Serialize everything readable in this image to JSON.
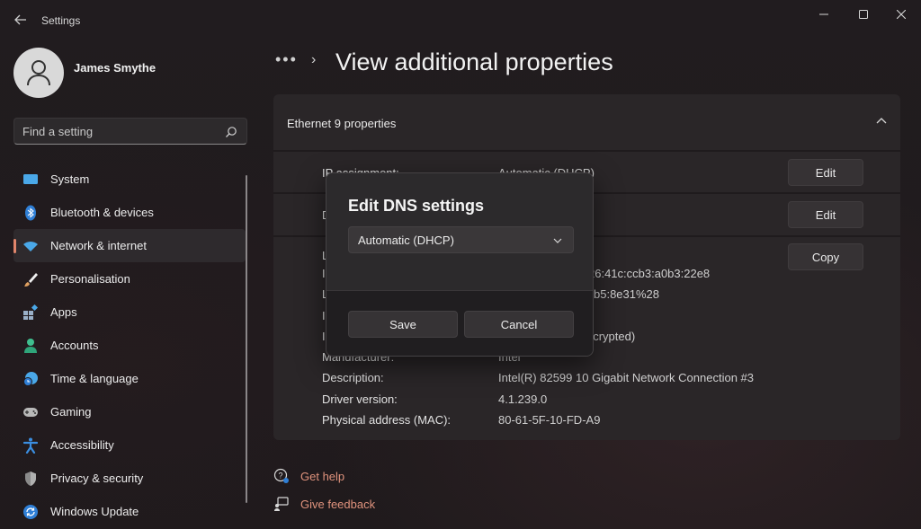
{
  "window": {
    "title": "Settings",
    "back_icon": "back-arrow-icon",
    "controls": [
      "minimize-icon",
      "maximize-icon",
      "close-icon"
    ]
  },
  "profile": {
    "name": "James Smythe"
  },
  "search": {
    "placeholder": "Find a setting"
  },
  "sidebar": {
    "items": [
      {
        "label": "System",
        "icon": "system-icon",
        "color": "#4aa8e8"
      },
      {
        "label": "Bluetooth & devices",
        "icon": "bluetooth-icon",
        "color": "#3b8ee0"
      },
      {
        "label": "Network & internet",
        "icon": "network-icon",
        "color": "#4aa8e8",
        "active": true
      },
      {
        "label": "Personalisation",
        "icon": "brush-icon",
        "color": "#e0a060"
      },
      {
        "label": "Apps",
        "icon": "apps-icon",
        "color": "#9ab0c8"
      },
      {
        "label": "Accounts",
        "icon": "accounts-icon",
        "color": "#3fbf8f"
      },
      {
        "label": "Time & language",
        "icon": "time-language-icon",
        "color": "#4aa8e8"
      },
      {
        "label": "Gaming",
        "icon": "gaming-icon",
        "color": "#b8b8b8"
      },
      {
        "label": "Accessibility",
        "icon": "accessibility-icon",
        "color": "#3b8ee0"
      },
      {
        "label": "Privacy & security",
        "icon": "shield-icon",
        "color": "#8a8a8a"
      },
      {
        "label": "Windows Update",
        "icon": "windows-update-icon",
        "color": "#3b8ee0"
      }
    ]
  },
  "header": {
    "more": "•••",
    "chevron": "›",
    "title": "View additional properties"
  },
  "card": {
    "title": "Ethernet 9 properties",
    "rows": [
      {
        "label": "IP assignment:",
        "value": "Automatic (DHCP)"
      },
      {
        "label": "D",
        "value": ""
      },
      {
        "label": "L",
        "value": ""
      },
      {
        "label": "I",
        "value": "26:41c:ccb3:a0b3:22e8"
      },
      {
        "label": "L",
        "value": "b5:8e31%28"
      },
      {
        "label": "I",
        "value": ""
      },
      {
        "label": "I",
        "value": "ncrypted)"
      },
      {
        "label": "Manufacturer:",
        "value": "Intel"
      },
      {
        "label": "Description:",
        "value": "Intel(R) 82599 10 Gigabit Network Connection #3"
      },
      {
        "label": "Driver version:",
        "value": "4.1.239.0"
      },
      {
        "label": "Physical address (MAC):",
        "value": "80-61-5F-10-FD-A9"
      }
    ],
    "buttons": {
      "edit_ip": "Edit",
      "edit_dns": "Edit",
      "copy": "Copy"
    }
  },
  "footer": {
    "get_help": "Get help",
    "give_feedback": "Give feedback"
  },
  "dialog": {
    "title": "Edit DNS settings",
    "select_value": "Automatic (DHCP)",
    "save": "Save",
    "cancel": "Cancel"
  },
  "colors": {
    "accent": "#e0856b",
    "link": "#e0937d"
  }
}
